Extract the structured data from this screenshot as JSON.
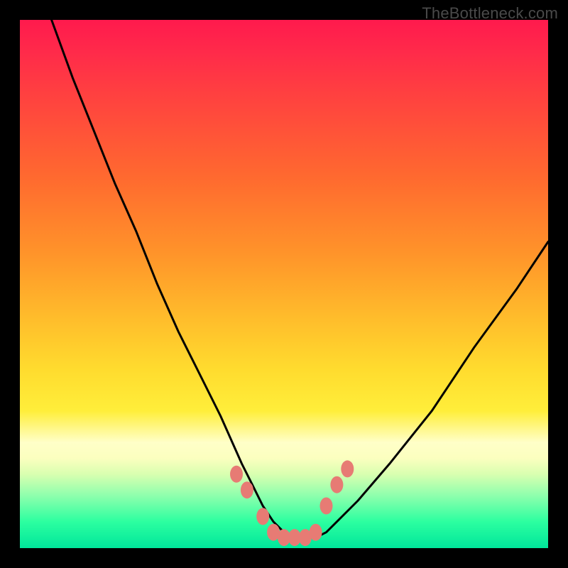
{
  "watermark": {
    "text": "TheBottleneck.com"
  },
  "colors": {
    "frame": "#000000",
    "curve": "#000000",
    "markerFill": "#e77b74",
    "markerStroke": "#b25952",
    "gradientStops": [
      "#ff1a4d",
      "#ff4040",
      "#ff932a",
      "#ffdb2e",
      "#ffffc8",
      "#2cffa0",
      "#00e69b"
    ]
  },
  "chart_data": {
    "type": "line",
    "title": "",
    "xlabel": "",
    "ylabel": "",
    "xlim": [
      0,
      100
    ],
    "ylim": [
      0,
      100
    ],
    "grid": false,
    "legend": false,
    "series": [
      {
        "name": "bottleneck-curve",
        "x": [
          6,
          10,
          14,
          18,
          22,
          26,
          30,
          34,
          38,
          42,
          44,
          46,
          48,
          50,
          52,
          54,
          56,
          58,
          60,
          64,
          70,
          78,
          86,
          94,
          100
        ],
        "values": [
          100,
          89,
          79,
          69,
          60,
          50,
          41,
          33,
          25,
          16,
          12,
          8,
          5,
          3,
          2,
          2,
          2,
          3,
          5,
          9,
          16,
          26,
          38,
          49,
          58
        ]
      }
    ],
    "markers": [
      {
        "x": 41,
        "y": 14
      },
      {
        "x": 43,
        "y": 11
      },
      {
        "x": 46,
        "y": 6
      },
      {
        "x": 48,
        "y": 3
      },
      {
        "x": 50,
        "y": 2
      },
      {
        "x": 52,
        "y": 2
      },
      {
        "x": 54,
        "y": 2
      },
      {
        "x": 56,
        "y": 3
      },
      {
        "x": 58,
        "y": 8
      },
      {
        "x": 60,
        "y": 12
      },
      {
        "x": 62,
        "y": 15
      }
    ]
  }
}
